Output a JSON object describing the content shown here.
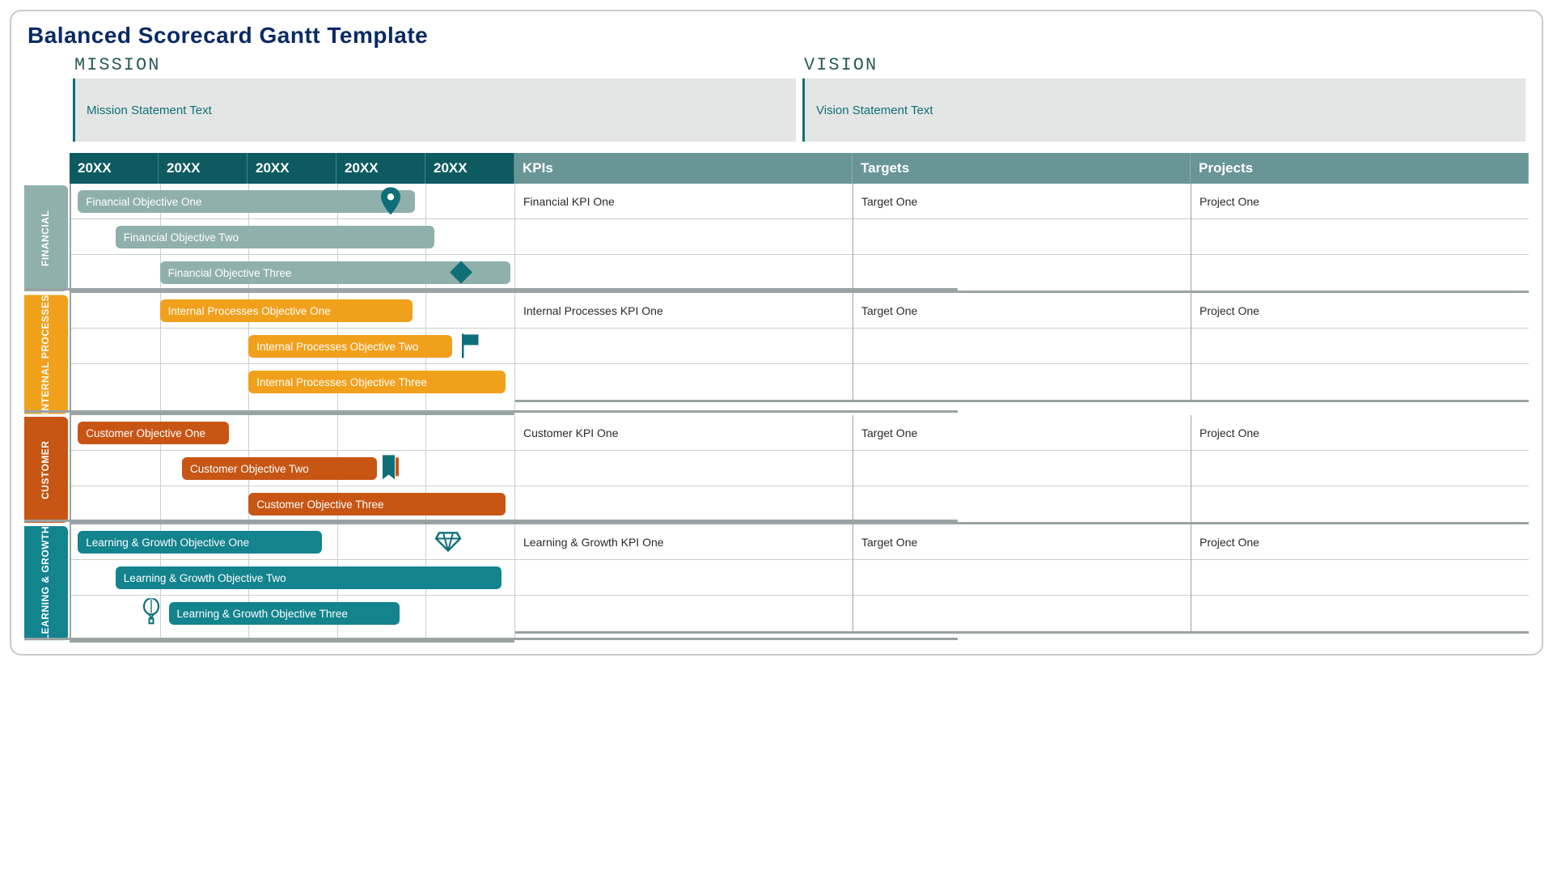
{
  "title": "Balanced Scorecard Gantt Template",
  "mission": {
    "heading": "MISSION",
    "text": "Mission Statement Text"
  },
  "vision": {
    "heading": "VISION",
    "text": "Vision Statement Text"
  },
  "periods": [
    "20XX",
    "20XX",
    "20XX",
    "20XX",
    "20XX"
  ],
  "columns": {
    "kpis": "KPIs",
    "targets": "Targets",
    "projects": "Projects"
  },
  "colors": {
    "financial_cat": "#8fb0ad",
    "financial_bar": "#8fb0ad",
    "internal_cat": "#f1a01b",
    "internal_bar": "#f1a01b",
    "customer_cat": "#c75514",
    "customer_bar": "#c75514",
    "learning_cat": "#13838e",
    "learning_bar": "#13838e",
    "milestone": "#0f6f78"
  },
  "categories": [
    {
      "id": "financial",
      "label": "FINANCIAL",
      "rows": [
        {
          "bar": {
            "label": "Financial Objective One",
            "start_pct": 1.5,
            "width_pct": 76
          },
          "marker": {
            "type": "pin",
            "pos_pct": 72
          },
          "kpi": "Financial KPI One",
          "target": "Target One",
          "project": "Project One"
        },
        {
          "bar": {
            "label": "Financial Objective Two",
            "start_pct": 10,
            "width_pct": 72
          },
          "marker": null,
          "kpi": "",
          "target": "",
          "project": ""
        },
        {
          "bar": {
            "label": "Financial Objective Three",
            "start_pct": 20,
            "width_pct": 79
          },
          "marker": {
            "type": "diamond",
            "pos_pct": 88
          },
          "kpi": "",
          "target": "",
          "project": ""
        }
      ]
    },
    {
      "id": "internal",
      "label": "INTERNAL PROCESSES",
      "rows": [
        {
          "bar": {
            "label": "Internal Processes Objective One",
            "start_pct": 20,
            "width_pct": 57
          },
          "marker": null,
          "kpi": "Internal Processes KPI One",
          "target": "Target One",
          "project": "Project One"
        },
        {
          "bar": {
            "label": "Internal Processes Objective Two",
            "start_pct": 40,
            "width_pct": 46
          },
          "marker": {
            "type": "flag",
            "pos_pct": 90
          },
          "kpi": "",
          "target": "",
          "project": ""
        },
        {
          "bar": {
            "label": "Internal Processes Objective Three",
            "start_pct": 40,
            "width_pct": 58
          },
          "marker": null,
          "kpi": "",
          "target": "",
          "project": ""
        }
      ]
    },
    {
      "id": "customer",
      "label": "CUSTOMER",
      "rows": [
        {
          "bar": {
            "label": "Customer Objective One",
            "start_pct": 1.5,
            "width_pct": 34
          },
          "marker": null,
          "kpi": "Customer KPI One",
          "target": "Target One",
          "project": "Project One"
        },
        {
          "bar": {
            "label": "Customer Objective Two",
            "start_pct": 25,
            "width_pct": 44
          },
          "marker": {
            "type": "bookmark",
            "pos_pct": 72
          },
          "kpi": "",
          "target": "",
          "project": ""
        },
        {
          "bar": {
            "label": "Customer Objective Three",
            "start_pct": 40,
            "width_pct": 58
          },
          "marker": null,
          "kpi": "",
          "target": "",
          "project": ""
        }
      ]
    },
    {
      "id": "learning",
      "label": "LEARNING & GROWTH",
      "rows": [
        {
          "bar": {
            "label": "Learning & Growth Objective One",
            "start_pct": 1.5,
            "width_pct": 55
          },
          "marker": {
            "type": "diamond-outline",
            "pos_pct": 85
          },
          "kpi": "Learning & Growth KPI One",
          "target": "Target One",
          "project": "Project One"
        },
        {
          "bar": {
            "label": "Learning & Growth Objective Two",
            "start_pct": 10,
            "width_pct": 87
          },
          "marker": null,
          "kpi": "",
          "target": "",
          "project": ""
        },
        {
          "bar": {
            "label": "Learning & Growth Objective Three",
            "start_pct": 22,
            "width_pct": 52
          },
          "marker": {
            "type": "balloon",
            "pos_pct": 18
          },
          "kpi": "",
          "target": "",
          "project": ""
        }
      ]
    }
  ]
}
